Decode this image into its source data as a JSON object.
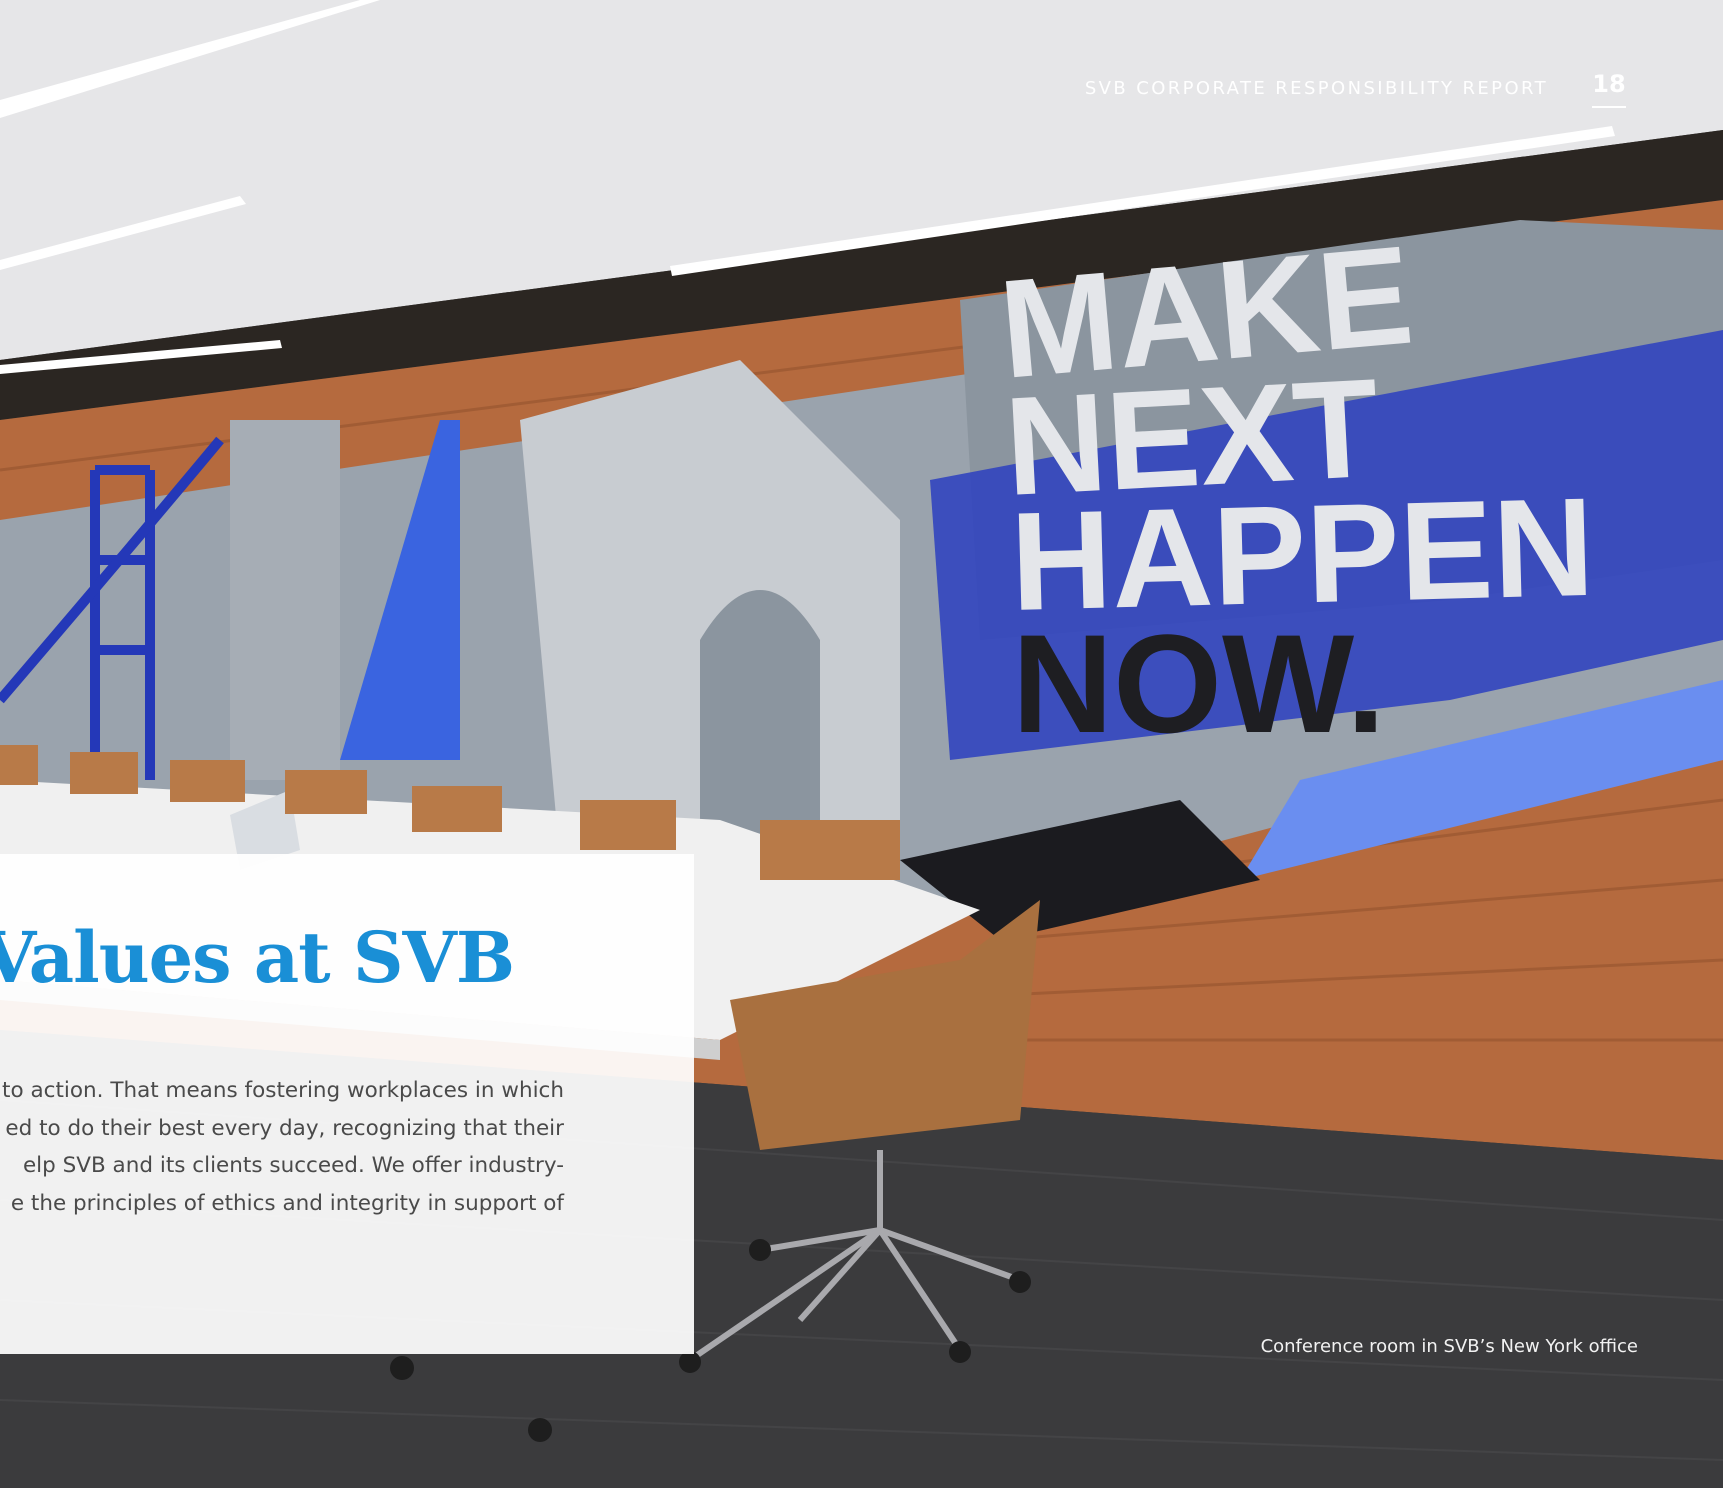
{
  "header": {
    "report_title": "SVB CORPORATE RESPONSIBILITY REPORT",
    "page_number": "18"
  },
  "mural": {
    "lines": [
      "MAKE",
      "NEXT",
      "HAPPEN",
      "NOW."
    ]
  },
  "panel": {
    "title": "r Values at SVB",
    "body_lines": [
      "to action. That means fostering workplaces in which",
      "ed to do their best every day, recognizing that their",
      "elp SVB and its clients succeed. We offer industry-",
      "e the principles of ethics and integrity in support of"
    ]
  },
  "caption": "Conference room in SVB’s New York office",
  "colors": {
    "title_blue": "#1a8fd6",
    "mural_blue": "#2b3fbf",
    "brick": "#b56a3e",
    "carpet": "#3b3b3d"
  }
}
